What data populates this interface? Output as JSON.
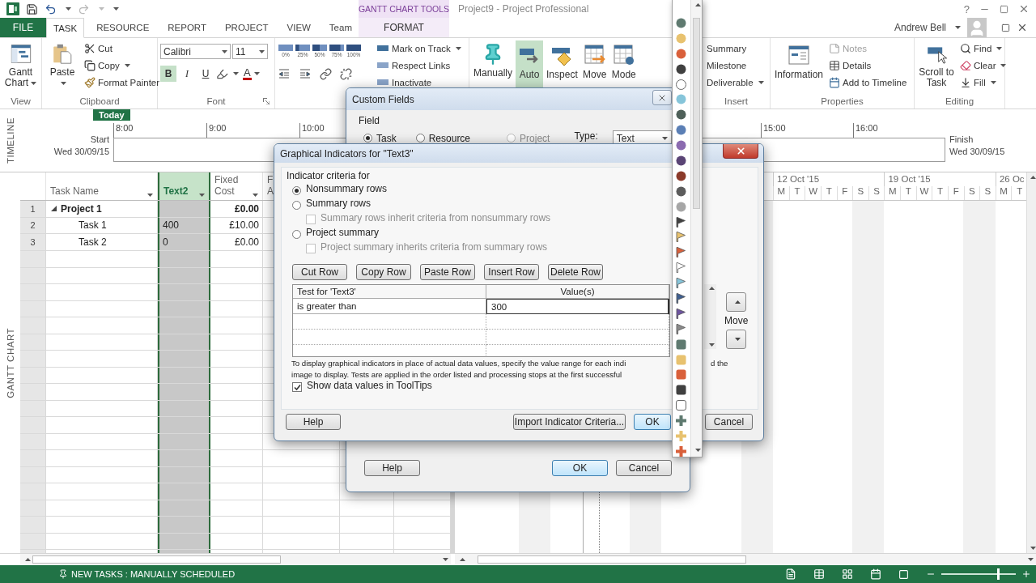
{
  "title_bar": {
    "contextual_label": "GANTT CHART TOOLS",
    "title": "Project9 - Project Professional",
    "help": "?"
  },
  "ribbon_tabs": [
    {
      "label": "FILE",
      "kind": "file",
      "selected": false
    },
    {
      "label": "TASK",
      "kind": "tab",
      "selected": true
    },
    {
      "label": "RESOURCE",
      "kind": "tab",
      "selected": false
    },
    {
      "label": "REPORT",
      "kind": "tab",
      "selected": false
    },
    {
      "label": "PROJECT",
      "kind": "tab",
      "selected": false
    },
    {
      "label": "VIEW",
      "kind": "tab",
      "selected": false
    },
    {
      "label": "Team",
      "kind": "tab",
      "selected": false
    },
    {
      "label": "FORMAT",
      "kind": "contextual",
      "selected": false
    }
  ],
  "user": {
    "name": "Andrew Bell"
  },
  "ribbon_groups": [
    {
      "kind": "view",
      "label": "View",
      "large": {
        "label": "Gantt Chart",
        "dropdown": true
      }
    },
    {
      "kind": "clipboard",
      "label": "Clipboard",
      "large": {
        "label": "Paste",
        "dropdown": true
      },
      "small": [
        {
          "label": "Cut",
          "dropdown": false
        },
        {
          "label": "Copy",
          "dropdown": true
        },
        {
          "label": "Format Painter",
          "dropdown": false
        }
      ]
    },
    {
      "kind": "font",
      "label": "Font",
      "font_name": "Calibri",
      "font_size": "11",
      "styles": [
        {
          "kind": "bold",
          "label": "B",
          "selected": true
        },
        {
          "kind": "italic",
          "label": "I",
          "selected": false
        },
        {
          "kind": "underline",
          "label": "U",
          "selected": false
        }
      ],
      "font_color_label": "A"
    },
    {
      "kind": "schedule",
      "percent_buttons": [
        "0%",
        "25%",
        "50%",
        "75%",
        "100%"
      ],
      "small": [
        {
          "label": "Mark on Track",
          "dropdown": true
        },
        {
          "label": "Respect Links",
          "dropdown": false
        },
        {
          "label": "Inactivate",
          "dropdown": false
        }
      ]
    },
    {
      "kind": "tasks",
      "large": [
        {
          "label": "Manually",
          "selected": false
        },
        {
          "label": "Auto",
          "selected": true
        },
        {
          "label": "Inspect",
          "selected": false
        },
        {
          "label": "Move",
          "selected": false
        },
        {
          "label": "Mode",
          "selected": false
        }
      ]
    },
    {
      "kind": "insert",
      "label": "Insert",
      "small": [
        {
          "label": "Summary",
          "dropdown": false
        },
        {
          "label": "Milestone",
          "dropdown": false
        },
        {
          "label": "Deliverable",
          "dropdown": true
        }
      ]
    },
    {
      "kind": "properties",
      "label": "Properties",
      "large": {
        "label": "Information",
        "dropdown": false
      },
      "small": [
        {
          "label": "Notes",
          "disabled": true
        },
        {
          "label": "Details",
          "disabled": false
        },
        {
          "label": "Add to Timeline",
          "disabled": false
        }
      ]
    },
    {
      "kind": "editing",
      "label": "Editing",
      "large": {
        "label": "Scroll to Task",
        "dropdown": false
      },
      "small": [
        {
          "label": "Find",
          "dropdown": true
        },
        {
          "label": "Clear",
          "dropdown": true
        },
        {
          "label": "Fill",
          "dropdown": true
        }
      ]
    }
  ],
  "timeline": {
    "side_label": "TIMELINE",
    "today": "Today",
    "start_label": "Start",
    "start_date": "Wed 30/09/15",
    "finish_label": "Finish",
    "finish_date": "Wed 30/09/15",
    "ticks_left": [
      "8:00",
      "9:00",
      "10:00"
    ],
    "ticks_right": [
      "15:00",
      "16:00"
    ]
  },
  "grid": {
    "side_label": "GANTT CHART",
    "columns": [
      {
        "label_lines": [
          "Task Name"
        ],
        "selected": false,
        "menu": true
      },
      {
        "label_lines": [
          "Text2"
        ],
        "selected": true,
        "menu": true
      },
      {
        "label_lines": [
          "Fixed",
          "Cost"
        ],
        "selected": false,
        "menu": true
      },
      {
        "label_lines": [
          "F",
          "A"
        ],
        "selected": false
      }
    ],
    "rows": [
      {
        "number": "1",
        "name": "Project 1",
        "fixed_cost": "£0.00",
        "expanded": true,
        "children": [
          {
            "number": "2",
            "name": "Task 1",
            "text2": "400",
            "fixed_cost": "£10.00"
          },
          {
            "number": "3",
            "name": "Task 2",
            "text2": "0",
            "fixed_cost": "£0.00"
          }
        ]
      }
    ]
  },
  "gantt": {
    "weeks": [
      {
        "label": "12 Oct '15",
        "days": [
          "M",
          "T",
          "W",
          "T",
          "F",
          "S",
          "S"
        ]
      },
      {
        "label": "19 Oct '15",
        "days": [
          "M",
          "T",
          "W",
          "T",
          "F",
          "S",
          "S"
        ]
      },
      {
        "label": "26 Oc",
        "days": [
          "M",
          "T"
        ]
      }
    ]
  },
  "custom_fields_dialog": {
    "title": "Custom Fields",
    "field_label": "Field",
    "entity_options": [
      {
        "label": "Task",
        "selected": true,
        "disabled": false
      },
      {
        "label": "Resource",
        "selected": false,
        "disabled": false
      },
      {
        "label": "Project",
        "selected": false,
        "disabled": true
      }
    ],
    "type_label": "Type:",
    "type_value": "Text",
    "buttons": [
      {
        "label": "Help",
        "kind": "help"
      },
      {
        "label": "OK",
        "kind": "default"
      },
      {
        "label": "Cancel",
        "kind": "cancel"
      }
    ]
  },
  "indicators_dialog": {
    "title": "Graphical Indicators for \"Text3\"",
    "criteria_label": "Indicator criteria for",
    "criteria_options": [
      {
        "label": "Nonsummary rows",
        "selected": true
      },
      {
        "label": "Summary rows",
        "selected": false,
        "sub_checkbox": {
          "label": "Summary rows inherit criteria from nonsummary rows",
          "checked": false,
          "disabled": true
        }
      },
      {
        "label": "Project summary",
        "selected": false,
        "sub_checkbox": {
          "label": "Project summary inherits criteria from summary rows",
          "checked": false,
          "disabled": true
        }
      }
    ],
    "row_buttons": [
      "Cut Row",
      "Copy Row",
      "Paste Row",
      "Insert Row",
      "Delete Row"
    ],
    "table": {
      "columns": [
        "Test for 'Text3'",
        "Value(s)"
      ],
      "rows": [
        {
          "test": "is greater than",
          "value": "300"
        }
      ]
    },
    "move_label": "Move",
    "description_lines": [
      {
        "left": "To display graphical indicators in place of actual data values, specify the value range for each indi",
        "right": "d the"
      },
      {
        "left": "image to display.  Tests are applied in the order listed and processing stops at the first successful"
      }
    ],
    "tooltip_checkbox": {
      "label": "Show data values in ToolTips",
      "checked": true
    },
    "buttons": [
      {
        "label": "Help",
        "kind": "help"
      },
      {
        "label": "Import Indicator Criteria...",
        "kind": "import"
      },
      {
        "label": "OK",
        "kind": "default"
      },
      {
        "label": "Cancel",
        "kind": "cancel"
      }
    ]
  },
  "indicator_palette": {
    "items": [
      {
        "kind": "circle",
        "color": "#5f7a70"
      },
      {
        "kind": "circle",
        "color": "#e8c26f"
      },
      {
        "kind": "circle",
        "color": "#d9603b"
      },
      {
        "kind": "circle",
        "color": "#404040"
      },
      {
        "kind": "circle",
        "color": "#ffffff"
      },
      {
        "kind": "circle",
        "color": "#86c5da"
      },
      {
        "kind": "circle",
        "color": "#4f6059"
      },
      {
        "kind": "circle",
        "color": "#5b7fb5"
      },
      {
        "kind": "circle",
        "color": "#8b6bb0"
      },
      {
        "kind": "circle",
        "color": "#5a4475"
      },
      {
        "kind": "circle",
        "color": "#8b3a2a"
      },
      {
        "kind": "circle",
        "color": "#5c5c5c"
      },
      {
        "kind": "circle",
        "color": "#a6a6a6"
      },
      {
        "kind": "flag",
        "color": "#404040"
      },
      {
        "kind": "flag",
        "color": "#e8c26f"
      },
      {
        "kind": "flag",
        "color": "#d9603b"
      },
      {
        "kind": "flag",
        "color": "#ffffff"
      },
      {
        "kind": "flag",
        "color": "#86c5da"
      },
      {
        "kind": "flag",
        "color": "#3f5f8f"
      },
      {
        "kind": "flag",
        "color": "#6e54a0"
      },
      {
        "kind": "flag",
        "color": "#8a8a8a"
      },
      {
        "kind": "square",
        "color": "#5f7a70"
      },
      {
        "kind": "square",
        "color": "#e8c26f"
      },
      {
        "kind": "square",
        "color": "#d9603b"
      },
      {
        "kind": "square",
        "color": "#404040"
      },
      {
        "kind": "square",
        "color": "#ffffff"
      },
      {
        "kind": "cross",
        "color": "#5f7a70"
      },
      {
        "kind": "cross",
        "color": "#e8c26f"
      },
      {
        "kind": "cross",
        "color": "#d9603b"
      }
    ]
  },
  "status_bar": {
    "new_tasks": "NEW TASKS : MANUALLY SCHEDULED",
    "zoom": {
      "level": 0.75
    }
  }
}
